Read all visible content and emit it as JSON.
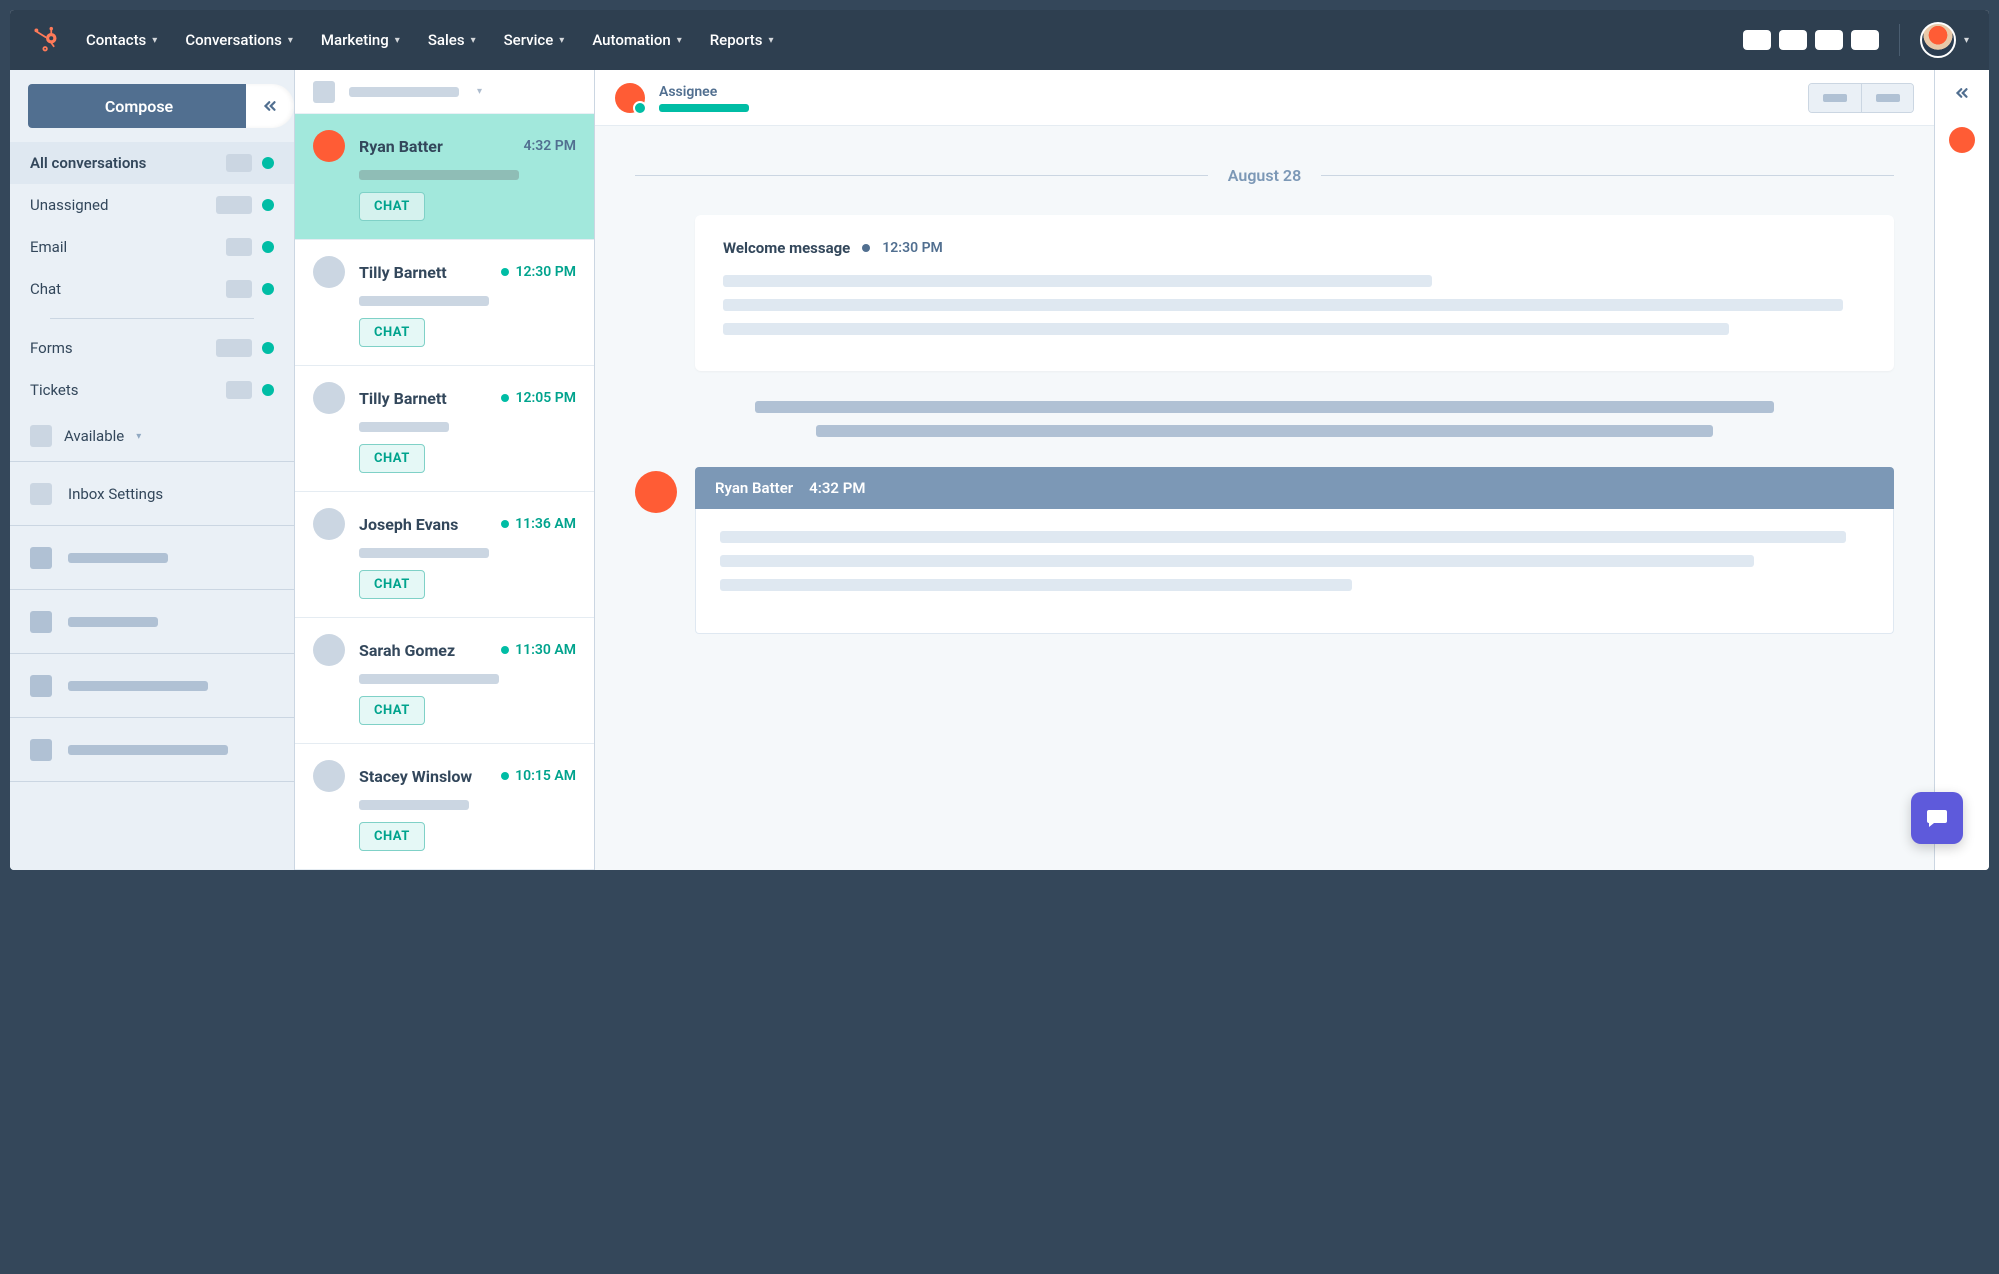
{
  "nav": {
    "items": [
      "Contacts",
      "Conversations",
      "Marketing",
      "Sales",
      "Service",
      "Automation",
      "Reports"
    ]
  },
  "sidebar": {
    "compose": "Compose",
    "filters": [
      {
        "label": "All conversations",
        "active": true,
        "wide": false
      },
      {
        "label": "Unassigned",
        "active": false,
        "wide": true
      },
      {
        "label": "Email",
        "active": false,
        "wide": false
      },
      {
        "label": "Chat",
        "active": false,
        "wide": false
      }
    ],
    "filters2": [
      {
        "label": "Forms",
        "wide": true
      },
      {
        "label": "Tickets",
        "wide": false
      }
    ],
    "available": "Available",
    "inbox_settings": "Inbox Settings"
  },
  "conversations": [
    {
      "name": "Ryan Batter",
      "time": "4:32 PM",
      "teal": false,
      "avatar": "orange",
      "badge": "CHAT",
      "selected": true,
      "previewW": 160
    },
    {
      "name": "Tilly Barnett",
      "time": "12:30 PM",
      "teal": true,
      "avatar": "gray",
      "badge": "CHAT",
      "selected": false,
      "previewW": 130
    },
    {
      "name": "Tilly Barnett",
      "time": "12:05 PM",
      "teal": true,
      "avatar": "gray",
      "badge": "CHAT",
      "selected": false,
      "previewW": 90
    },
    {
      "name": "Joseph Evans",
      "time": "11:36 AM",
      "teal": true,
      "avatar": "gray",
      "badge": "CHAT",
      "selected": false,
      "previewW": 130
    },
    {
      "name": "Sarah Gomez",
      "time": "11:30 AM",
      "teal": true,
      "avatar": "gray",
      "badge": "CHAT",
      "selected": false,
      "previewW": 140
    },
    {
      "name": "Stacey Winslow",
      "time": "10:15 AM",
      "teal": true,
      "avatar": "gray",
      "badge": "CHAT",
      "selected": false,
      "previewW": 110
    }
  ],
  "thread": {
    "assignee_label": "Assignee",
    "date": "August 28",
    "welcome": {
      "title": "Welcome message",
      "time": "12:30 PM"
    },
    "reply": {
      "name": "Ryan Batter",
      "time": "4:32 PM"
    }
  }
}
